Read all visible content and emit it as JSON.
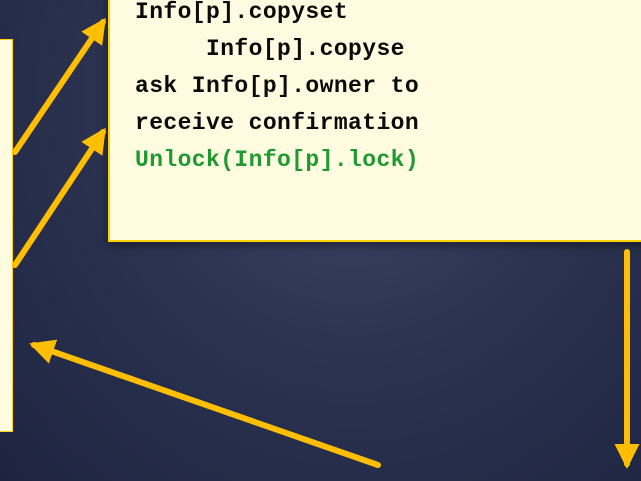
{
  "colors": {
    "background": "#2c3452",
    "box_fill": "#fffbe0",
    "box_border": "#ffd200",
    "arrow": "#ffbe00",
    "code_text": "#0a0a0a",
    "code_highlight": "#1e9a30"
  },
  "code_box": {
    "lines": [
      {
        "text": "Info[p].copyset",
        "style": "normal"
      },
      {
        "text": "     Info[p].copyse",
        "style": "normal"
      },
      {
        "text": "ask Info[p].owner to",
        "style": "normal"
      },
      {
        "text": "receive confirmation",
        "style": "normal"
      },
      {
        "text": "Unlock(Info[p].lock)",
        "style": "highlight"
      }
    ]
  },
  "arrows": [
    {
      "name": "arrow-left-to-code-line-1",
      "direction": "up-right"
    },
    {
      "name": "arrow-left-to-code-line-2",
      "direction": "up-right"
    },
    {
      "name": "arrow-bottom-to-left-box",
      "direction": "up-left"
    },
    {
      "name": "arrow-code-box-down",
      "direction": "down"
    }
  ]
}
